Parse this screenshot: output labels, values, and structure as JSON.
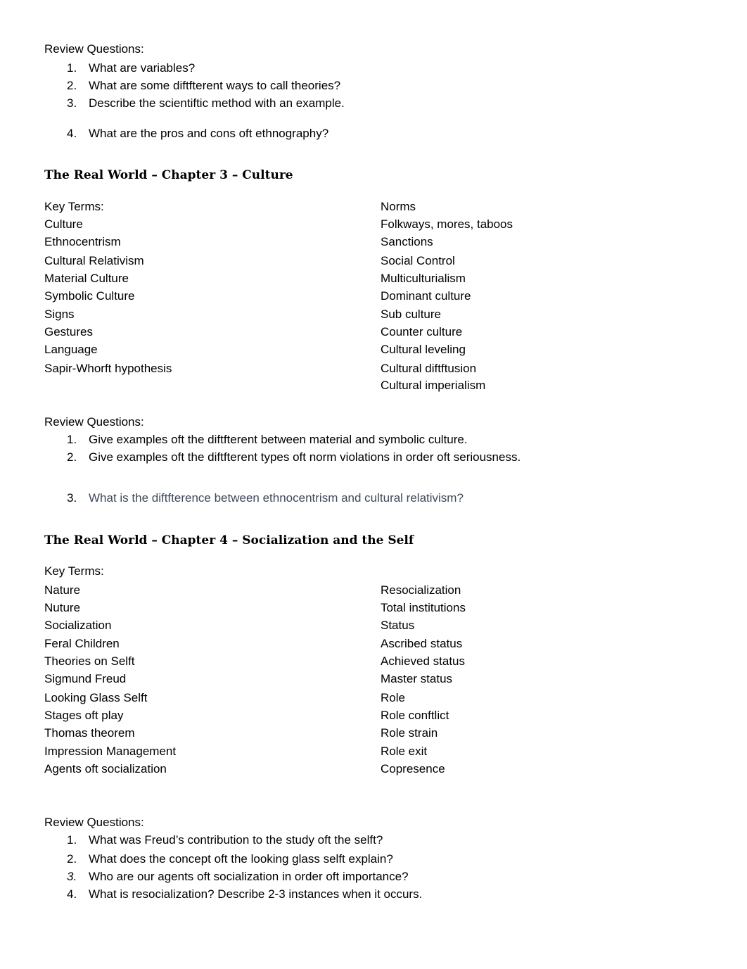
{
  "section1": {
    "review_label": "Review Questions:",
    "questions": [
      {
        "num": "1.",
        "text": "What are variables?"
      },
      {
        "num": "2.",
        "text": "What are some diftfterent ways to call theories?"
      },
      {
        "num": "3.",
        "text": "Describe the scientiftic method with an example."
      },
      {
        "num": "4.",
        "text": "What are the pros and cons oft ethnography?"
      }
    ]
  },
  "chapter3": {
    "heading": "The Real World – Chapter 3 – Culture",
    "key_terms_label": "Key Terms:",
    "left_terms": [
      "Culture",
      "Ethnocentrism",
      "Cultural Relativism",
      "Material Culture",
      "Symbolic Culture",
      "Signs",
      "Gestures",
      "Language",
      "Sapir-Whorft hypothesis"
    ],
    "right_terms": [
      "Norms",
      "Folkways, mores, taboos",
      "Sanctions",
      "Social Control",
      "Multiculturialism",
      "Dominant culture",
      "Sub culture",
      "Counter culture",
      "Cultural leveling",
      "Cultural diftftusion",
      "Cultural imperialism"
    ],
    "review_label": "Review Questions:",
    "questions": [
      {
        "num": "1.",
        "text": "Give examples oft the diftfterent between material and symbolic culture."
      },
      {
        "num": "2.",
        "text": "Give examples oft the diftfterent types oft norm violations in order oft seriousness."
      },
      {
        "num": "3.",
        "text": "What is the diftfterence between ethnocentrism and cultural relativism?"
      }
    ],
    "muted_color": "#3c4a5a"
  },
  "chapter4": {
    "heading": "The Real World – Chapter 4 – Socialization and the Self",
    "key_terms_label": "Key Terms:",
    "left_terms": [
      "Nature",
      "Nuture",
      "Socialization",
      "Feral Children",
      "Theories on Selft",
      "Sigmund Freud",
      "Looking Glass Selft",
      "Stages oft play",
      "Thomas theorem",
      "Impression Management",
      "Agents oft socialization"
    ],
    "right_terms": [
      "Resocialization",
      "Total institutions",
      "Status",
      "Ascribed status",
      "Achieved status",
      "Master status",
      "Role",
      "Role conftlict",
      "Role strain",
      "Role exit",
      "Copresence"
    ],
    "review_label": "Review Questions:",
    "questions": [
      {
        "num": "1.",
        "text": "What was Freud’s contribution to the study oft the selft?"
      },
      {
        "num": "2.",
        "text": "What does the concept oft the looking glass selft explain?"
      },
      {
        "num": "3.",
        "text": "Who are our agents oft socialization in order oft importance?"
      },
      {
        "num": "4.",
        "text": "What is resocialization? Describe 2-3 instances when it occurs."
      }
    ]
  }
}
